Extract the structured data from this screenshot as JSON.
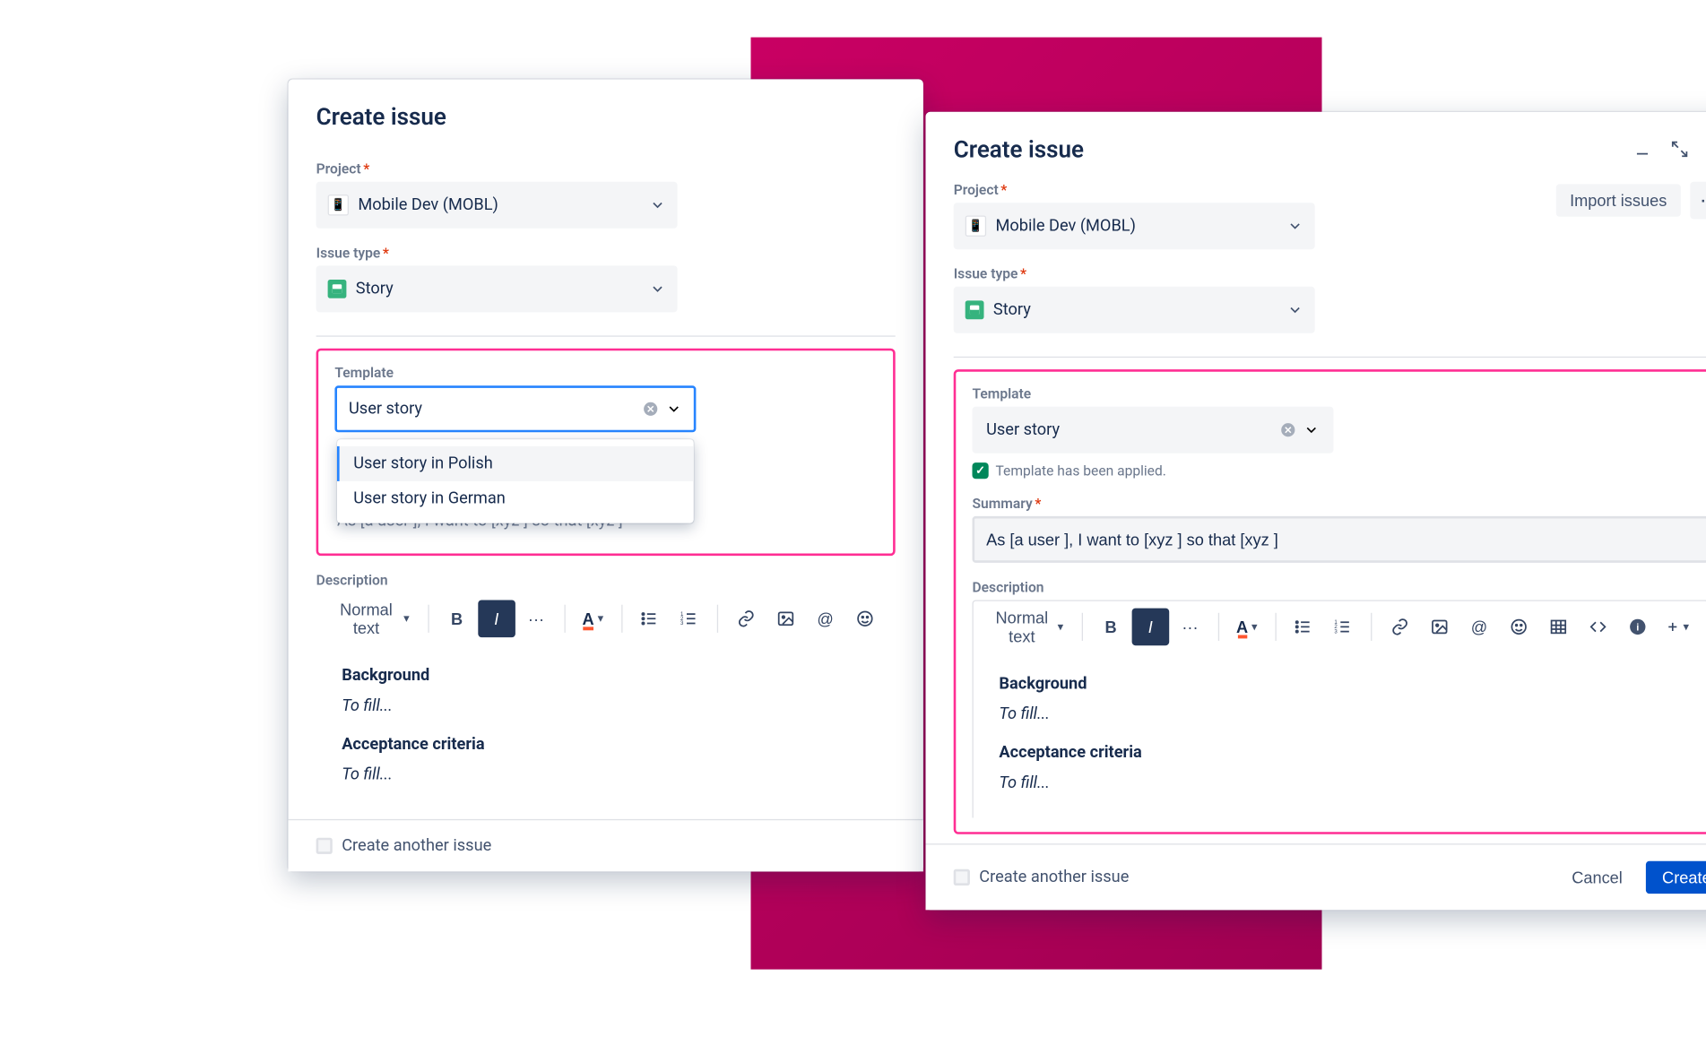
{
  "shared": {
    "dialog_title": "Create issue",
    "project_label": "Project",
    "project_value": "Mobile Dev (MOBL)",
    "issue_type_label": "Issue type",
    "issue_type_value": "Story",
    "template_label": "Template",
    "template_value": "User story",
    "summary_label": "Summary",
    "summary_value": "As [a user ], I want to [xyz ] so that [xyz ]",
    "description_label": "Description",
    "normal_text": "Normal text",
    "create_another": "Create another issue",
    "body_heading1": "Background",
    "body_fill1": "To fill...",
    "body_heading2": "Acceptance criteria",
    "body_fill2": "To fill..."
  },
  "left": {
    "dropdown_options": [
      "User story in Polish",
      "User story in German"
    ]
  },
  "right": {
    "import_issues": "Import issues",
    "applied_text": "Template has been applied.",
    "cancel": "Cancel",
    "create": "Create"
  }
}
